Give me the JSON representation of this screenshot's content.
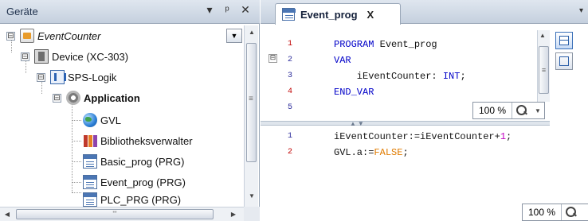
{
  "left_pane": {
    "title": "Geräte",
    "controls": {
      "dropdown": "▾",
      "pin": "ᵖ",
      "close": "✕"
    },
    "tree": [
      {
        "label": "EventCounter",
        "icon": "project-icon",
        "expander": "⊟",
        "style": "italic"
      },
      {
        "label": "Device (XC-303)",
        "icon": "device-icon",
        "expander": "⊟",
        "style": "normal"
      },
      {
        "label": "SPS-Logik",
        "icon": "plc-logic-icon",
        "expander": "⊟",
        "style": "normal"
      },
      {
        "label": "Application",
        "icon": "application-icon",
        "expander": "⊟",
        "style": "bold"
      },
      {
        "label": "GVL",
        "icon": "globe-icon",
        "style": "normal"
      },
      {
        "label": "Bibliotheksverwalter",
        "icon": "library-icon",
        "style": "normal"
      },
      {
        "label": "Basic_prog (PRG)",
        "icon": "pou-icon",
        "style": "normal"
      },
      {
        "label": "Event_prog (PRG)",
        "icon": "pou-icon",
        "style": "normal"
      },
      {
        "label": "PLC_PRG (PRG)",
        "icon": "pou-icon",
        "style": "normal"
      }
    ],
    "hscroll_thumb": "'''",
    "vscroll_thumb": "≡"
  },
  "editor": {
    "tab_label": "Event_prog",
    "tab_close": "X",
    "tab_dropdown": "▾",
    "declaration": {
      "lines": [
        {
          "num": "1",
          "tokens": [
            {
              "t": "PROGRAM",
              "c": "kw"
            },
            {
              "t": " Event_prog",
              "c": "id"
            }
          ]
        },
        {
          "num": "2",
          "tokens": [
            {
              "t": "VAR",
              "c": "kw"
            }
          ]
        },
        {
          "num": "3",
          "tokens": [
            {
              "t": "    iEventCounter: ",
              "c": "id"
            },
            {
              "t": "INT",
              "c": "ty"
            },
            {
              "t": ";",
              "c": "id"
            }
          ]
        },
        {
          "num": "4",
          "tokens": [
            {
              "t": "END_VAR",
              "c": "kw"
            }
          ]
        },
        {
          "num": "5",
          "tokens": []
        }
      ],
      "zoom": "100 %"
    },
    "implementation": {
      "lines": [
        {
          "num": "1",
          "tokens": [
            {
              "t": "iEventCounter:=iEventCounter+",
              "c": "id"
            },
            {
              "t": "1",
              "c": "num"
            },
            {
              "t": ";",
              "c": "id"
            }
          ]
        },
        {
          "num": "2",
          "tokens": [
            {
              "t": "GVL.a:=",
              "c": "id"
            },
            {
              "t": "FALSE",
              "c": "lit"
            },
            {
              "t": ";",
              "c": "id"
            }
          ]
        }
      ],
      "zoom": "100 %"
    },
    "splitter_grip": "▲▼"
  },
  "colors": {
    "keyword": "#0000c8",
    "literal": "#e07b00",
    "number": "#c000c0",
    "line_number_red": "#c00000",
    "header_bg": "#c5d0de"
  }
}
